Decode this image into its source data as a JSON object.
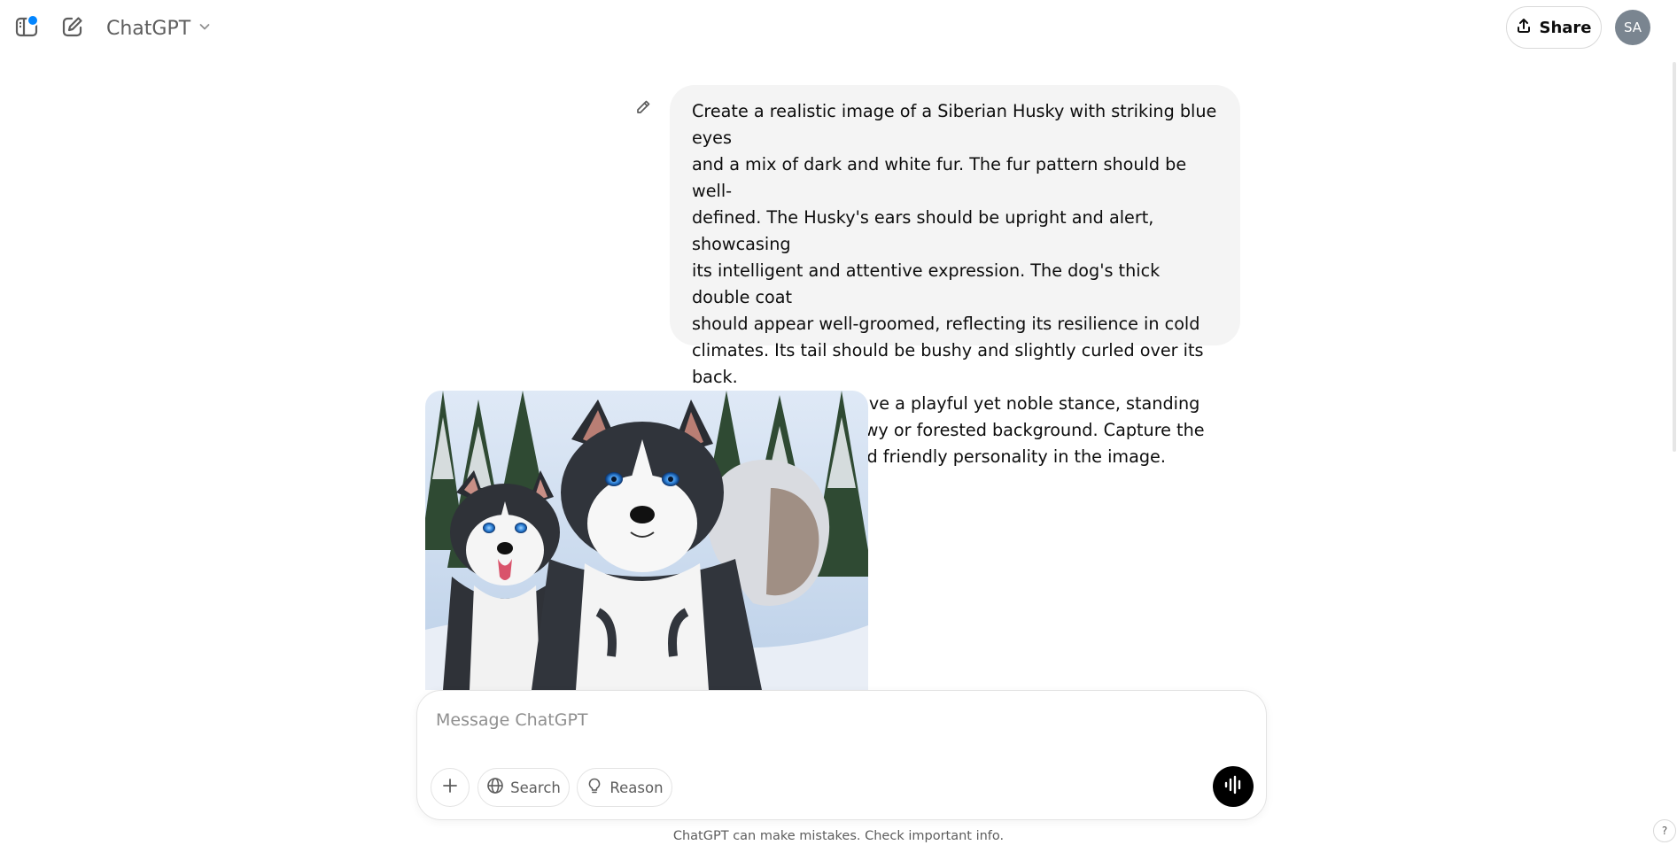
{
  "header": {
    "model_name": "ChatGPT",
    "share_label": "Share",
    "avatar_initials": "SA",
    "notification_dot_color": "#0285ff"
  },
  "conversation": {
    "user_message": "Create a realistic image of a Siberian Husky with striking blue eyes\nand a mix of dark and white fur. The fur pattern should be well-\ndefined. The Husky's ears should be upright and alert, showcasing\nits intelligent and attentive expression. The dog's thick double coat\nshould appear well-groomed, reflecting its resilience in cold\nclimates. Its tail should be bushy and slightly curled over its back.\nThe Husky should have a playful yet noble stance, standing\nconfidently on a snowy or forested background. Capture the\nbreed's energetic and friendly personality in the image."
  },
  "composer": {
    "placeholder": "Message ChatGPT",
    "search_label": "Search",
    "reason_label": "Reason"
  },
  "footer": {
    "disclaimer": "ChatGPT can make mistakes. Check important info.",
    "help_label": "?"
  },
  "icons": {
    "sidebar": "sidebar-toggle-icon",
    "new_chat": "compose-icon",
    "chevron": "chevron-down-icon",
    "share": "upload-icon",
    "edit": "pencil-icon",
    "plus": "plus-icon",
    "globe": "globe-icon",
    "lightbulb": "lightbulb-icon",
    "voice": "voice-waveform-icon"
  }
}
